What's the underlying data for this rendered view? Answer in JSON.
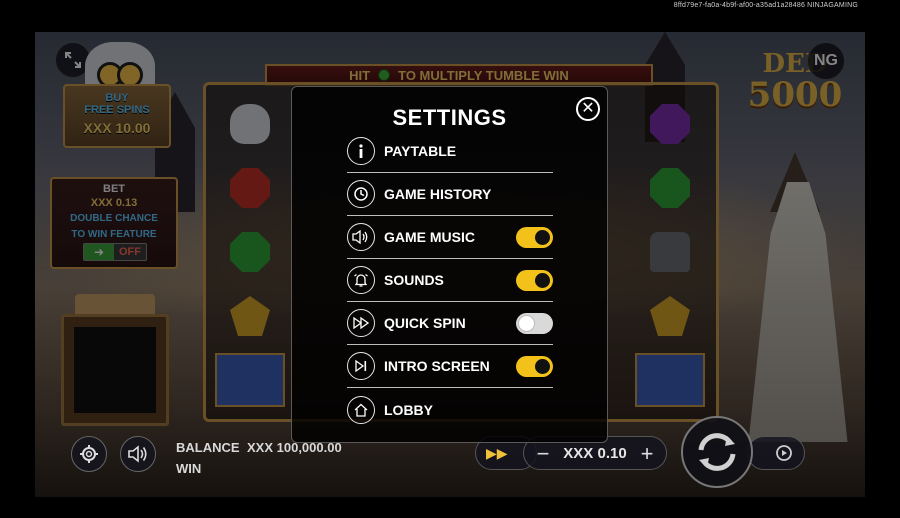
{
  "session_id": "8ffd79e7-fa0a-4b9f-af00-a35ad1a28486 NINJAGAMING",
  "game": {
    "title_line1": "DED",
    "title_line2": "5000",
    "provider_logo": "NG",
    "banner": {
      "left": "HIT",
      "right": "TO MULTIPLY TUMBLE WIN"
    },
    "buy_free_spins": {
      "line1": "BUY",
      "line2": "FREE SPINS",
      "cost": "XXX 10.00"
    },
    "bet_panel": {
      "title": "BET",
      "value": "XXX 0.13",
      "feature_line1": "DOUBLE CHANCE",
      "feature_line2": "TO WIN FEATURE",
      "toggle_label": "OFF"
    },
    "bottom": {
      "balance_label": "BALANCE",
      "balance_value": "XXX 100,000.00",
      "win_label": "WIN",
      "stake_value": "XXX 0.10",
      "minus": "−",
      "plus": "+"
    }
  },
  "settings": {
    "title": "SETTINGS",
    "close": "✕",
    "items": [
      {
        "label": "PAYTABLE",
        "icon": "info-icon",
        "toggle": null
      },
      {
        "label": "GAME HISTORY",
        "icon": "clock-icon",
        "toggle": null
      },
      {
        "label": "GAME MUSIC",
        "icon": "speaker-icon",
        "toggle": "on"
      },
      {
        "label": "SOUNDS",
        "icon": "bell-icon",
        "toggle": "on"
      },
      {
        "label": "QUICK SPIN",
        "icon": "fast-forward-icon",
        "toggle": "off"
      },
      {
        "label": "INTRO SCREEN",
        "icon": "skip-icon",
        "toggle": "on"
      },
      {
        "label": "LOBBY",
        "icon": "home-icon",
        "toggle": null
      }
    ]
  },
  "colors": {
    "toggle_on": "#f2c21b",
    "toggle_off": "#d9d9d9",
    "accent_gold": "#c99a4a",
    "accent_blue": "#5ec8ff"
  }
}
